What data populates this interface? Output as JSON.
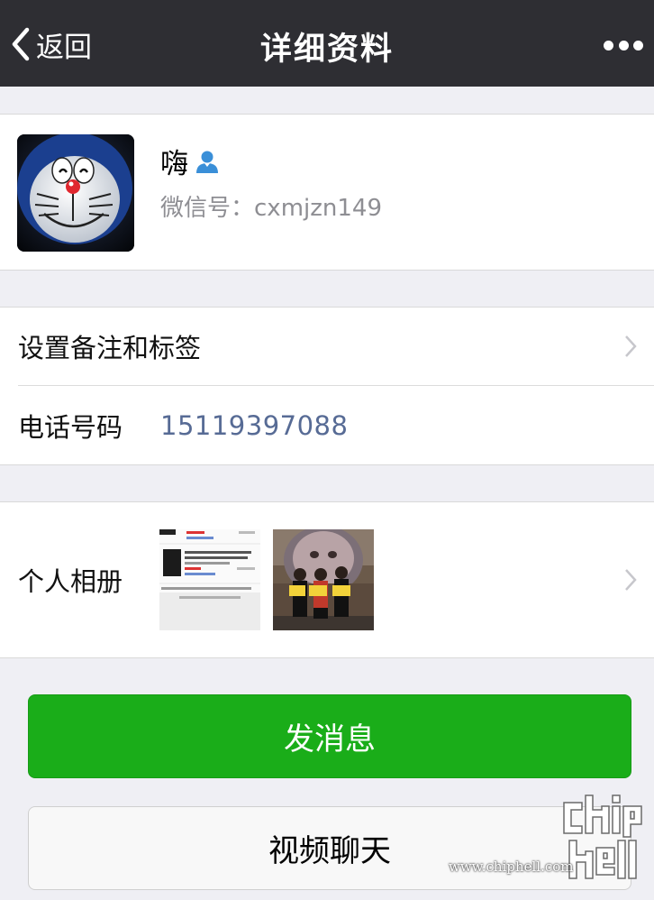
{
  "nav": {
    "back_label": "返回",
    "title": "详细资料",
    "more_icon": "more-dots-icon"
  },
  "profile": {
    "nickname": "嗨",
    "wechat_id_label": "微信号：",
    "wechat_id": "cxmjzn149",
    "badge_icon": "contact-person-icon"
  },
  "rows": {
    "remark_tags": "设置备注和标签",
    "phone_label": "电话号码",
    "phone_value": "15119397088",
    "album_label": "个人相册"
  },
  "buttons": {
    "send_message": "发消息",
    "video_chat": "视频聊天"
  },
  "watermark": {
    "url": "www.chiphell.com"
  },
  "colors": {
    "navbar": "#2e2e33",
    "background": "#efeff4",
    "primary_green": "#1aad19",
    "link_blue": "#576b95"
  }
}
